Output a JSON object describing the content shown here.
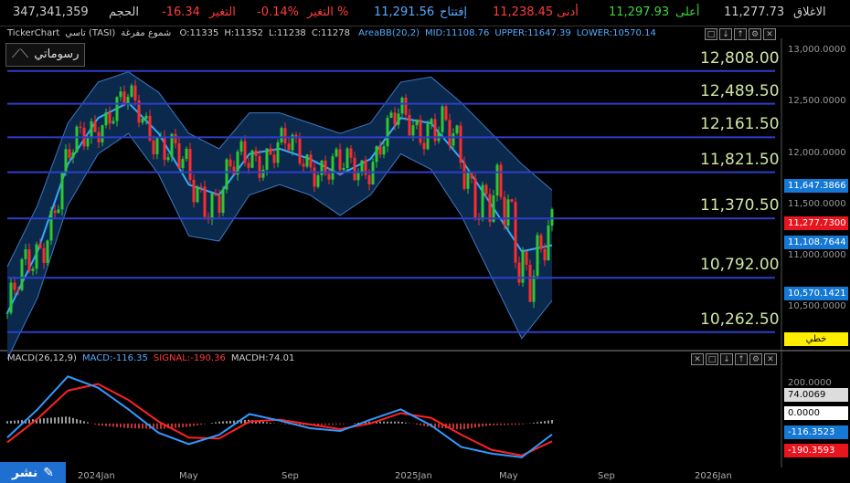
{
  "stats": {
    "close_label": "الاغلاق",
    "close_value": "11,277.73",
    "high_label": "أعلى",
    "high_value": "11,297.93",
    "low_label": "أدنى",
    "low_value": "11,238.45",
    "open_label": "إفتتاح",
    "open_value": "11,291.56",
    "changepct_label": "التغير %",
    "changepct_value": "-0.14%",
    "change_label": "التغير",
    "change_value": "-16.34",
    "volume_label": "الحجم",
    "volume_value": "347,341,359"
  },
  "price_header": {
    "source": "TickerChart",
    "symbol": "تاسي (TASI)",
    "chart_style": "شموع مفرغة",
    "o": "O:11335",
    "h": "H:11352",
    "l": "L:11238",
    "c": "C:11278",
    "bb": "AreaBB(20,2)",
    "mid": "MID:11108.76",
    "upper": "UPPER:11647.39",
    "lower": "LOWER:10570.14"
  },
  "macd_header": {
    "name": "MACD(26,12,9)",
    "macd": "MACD:-116.35",
    "signal": "SIGNAL:-190.36",
    "hist": "MACDH:74.01"
  },
  "drawing_button": "رسوماتي",
  "publish_button": "نشر",
  "scale_mode": "خطي",
  "levels": [
    "12,808.00",
    "12,489.50",
    "12,161.50",
    "11,821.50",
    "11,370.50",
    "10,792.00",
    "10,262.50"
  ],
  "price_axis_ticks": [
    "13,000.0000",
    "12,500.0000",
    "12,000.0000",
    "11,500.0000",
    "11,000.0000",
    "10,500.0000"
  ],
  "price_tags": {
    "upper": "11,647.3866",
    "close": "11,277.7300",
    "mid": "11,108.7644",
    "lower": "10,570.1421"
  },
  "macd_axis_ticks": [
    "200.0000"
  ],
  "macd_tags": {
    "hist": "74.0069",
    "zero": "0.0000",
    "macd": "-116.3523",
    "signal": "-190.3593"
  },
  "time_labels": [
    "2024Jan",
    "May",
    "Sep",
    "2025Jan",
    "May",
    "Sep",
    "2026Jan"
  ],
  "colors": {
    "up": "#2ec72e",
    "down": "#ff2a2a",
    "bb_fill": "#0c2e55",
    "bb_line": "#3b78c4",
    "mid": "#33aaff",
    "level": "#2d3fc8",
    "macd": "#3399ff",
    "signal": "#ff2222"
  },
  "chart_data": {
    "type": "line",
    "title": "تاسي (TASI)",
    "price_ylim": [
      10100,
      13100
    ],
    "horizontal_levels": [
      12808.0,
      12489.5,
      12161.5,
      11821.5,
      11370.5,
      10792.0,
      10262.5
    ],
    "bollinger": {
      "period": 20,
      "stddev": 2,
      "mid": 11108.76,
      "upper": 11647.39,
      "lower": 10570.14
    },
    "last_bar": {
      "open": 11335,
      "high": 11352,
      "low": 11238,
      "close": 11278
    },
    "x": [
      "2023-12",
      "2024-01",
      "2024-02",
      "2024-03",
      "2024-04",
      "2024-05",
      "2024-06",
      "2024-07",
      "2024-08",
      "2024-09",
      "2024-10",
      "2024-11",
      "2024-12",
      "2025-01",
      "2025-02",
      "2025-03",
      "2025-04",
      "2025-05",
      "2025-06"
    ],
    "series": [
      {
        "name": "MID",
        "values": [
          10450,
          11050,
          11900,
          12350,
          12500,
          12200,
          11700,
          11600,
          12000,
          12050,
          11950,
          11800,
          11950,
          12350,
          12300,
          11950,
          11500,
          11050,
          11109
        ]
      },
      {
        "name": "UPPER",
        "values": [
          10900,
          11500,
          12300,
          12700,
          12800,
          12600,
          12200,
          12050,
          12400,
          12400,
          12300,
          12200,
          12300,
          12700,
          12750,
          12500,
          12200,
          11900,
          11647
        ]
      },
      {
        "name": "LOWER",
        "values": [
          10000,
          10600,
          11500,
          12000,
          12200,
          11800,
          11200,
          11150,
          11600,
          11700,
          11600,
          11400,
          11600,
          12000,
          11850,
          11400,
          10800,
          10200,
          10570
        ]
      },
      {
        "name": "MACD",
        "values": [
          -150,
          150,
          500,
          380,
          150,
          -100,
          -220,
          -120,
          100,
          30,
          -50,
          -80,
          40,
          150,
          -20,
          -250,
          -320,
          -360,
          -116
        ]
      },
      {
        "name": "SIGNAL",
        "values": [
          -200,
          50,
          350,
          420,
          250,
          20,
          -150,
          -160,
          20,
          40,
          -10,
          -60,
          0,
          110,
          60,
          -120,
          -280,
          -340,
          -190
        ]
      }
    ],
    "macd_ylim": [
      -400,
      600
    ]
  }
}
